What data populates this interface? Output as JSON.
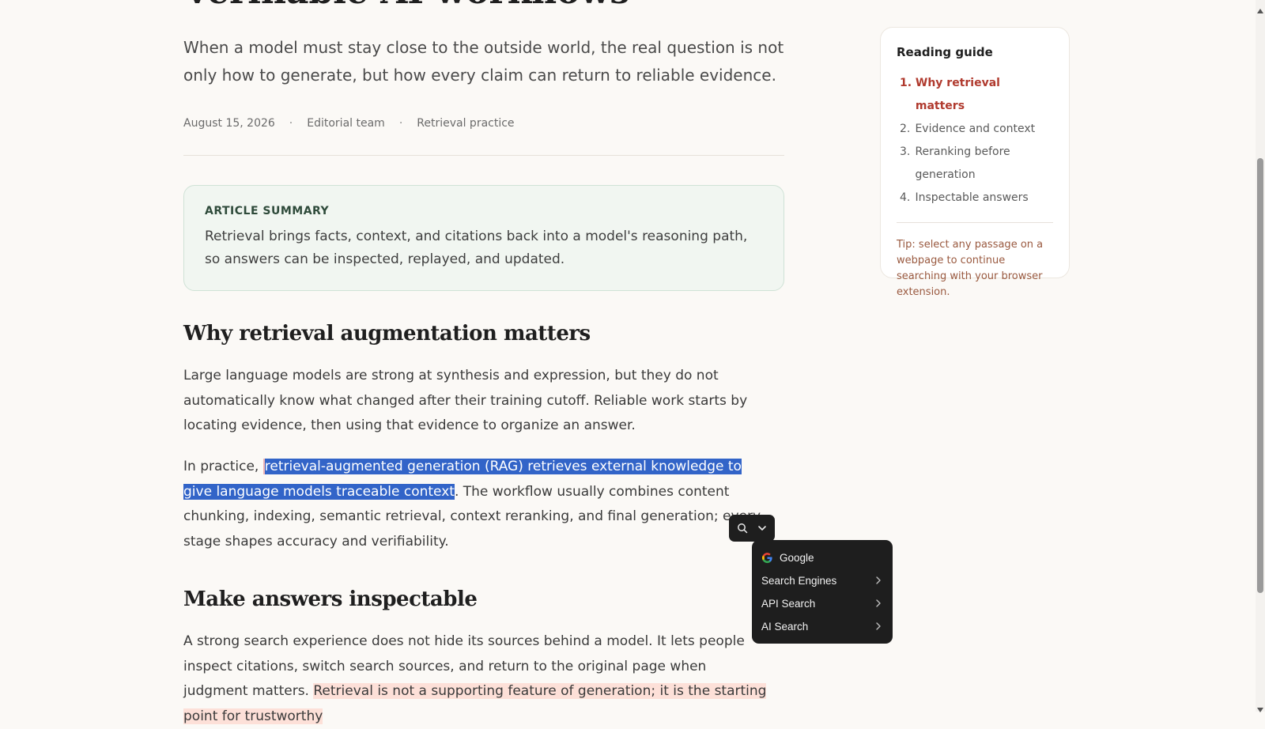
{
  "article": {
    "title": "Verifiable AI workflows",
    "lede": "When a model must stay close to the outside world, the real question is not only how to generate, but how every claim can return to reliable evidence.",
    "meta": {
      "date": "August 15, 2026",
      "separator": "·",
      "author": "Editorial team",
      "category": "Retrieval practice"
    },
    "summary": {
      "label": "ARTICLE SUMMARY",
      "text": "Retrieval brings facts, context, and citations back into a model's reasoning path, so answers can be inspected, replayed, and updated."
    },
    "section1": {
      "heading": "Why retrieval augmentation matters",
      "p1": "Large language models are strong at synthesis and expression, but they do not automatically know what changed after their training cutoff. Reliable work starts by locating evidence, then using that evidence to organize an answer.",
      "p2_before": "In practice, ",
      "p2_selected": "retrieval-augmented generation (RAG) retrieves external knowledge to give language models traceable context",
      "p2_after": ". The workflow usually combines content chunking, indexing, semantic retrieval, context reranking, and final generation; every stage shapes accuracy and verifiability."
    },
    "section2": {
      "heading": "Make answers inspectable",
      "p1": "A strong search experience does not hide its sources behind a model. It lets people inspect citations, switch search sources, and return to the original page when judgment matters.",
      "p2_highlight": "Retrieval is not a supporting feature of generation; it is the starting point for trustworthy"
    }
  },
  "guide": {
    "title": "Reading guide",
    "items": [
      {
        "num": "1.",
        "label": "Why retrieval matters",
        "active": true
      },
      {
        "num": "2.",
        "label": "Evidence and context",
        "active": false
      },
      {
        "num": "3.",
        "label": "Reranking before generation",
        "active": false
      },
      {
        "num": "4.",
        "label": "Inspectable answers",
        "active": false
      }
    ],
    "tip": "Tip: select any passage on a webpage to continue searching with your browser extension."
  },
  "popup": {
    "icons": [
      "search-icon",
      "chevron-down-icon"
    ],
    "menu": [
      {
        "label": "Google",
        "icon": "google-logo-icon",
        "submenu": false
      },
      {
        "label": "Search Engines",
        "submenu": true
      },
      {
        "label": "API Search",
        "submenu": true
      },
      {
        "label": "AI Search",
        "submenu": true
      }
    ]
  },
  "colors": {
    "selection": "#3264c8",
    "accent": "#b03a2e",
    "highlight": "#fde0d8",
    "summary_bg": "#f1f6f1",
    "popup_bg": "#1e1e1e"
  }
}
